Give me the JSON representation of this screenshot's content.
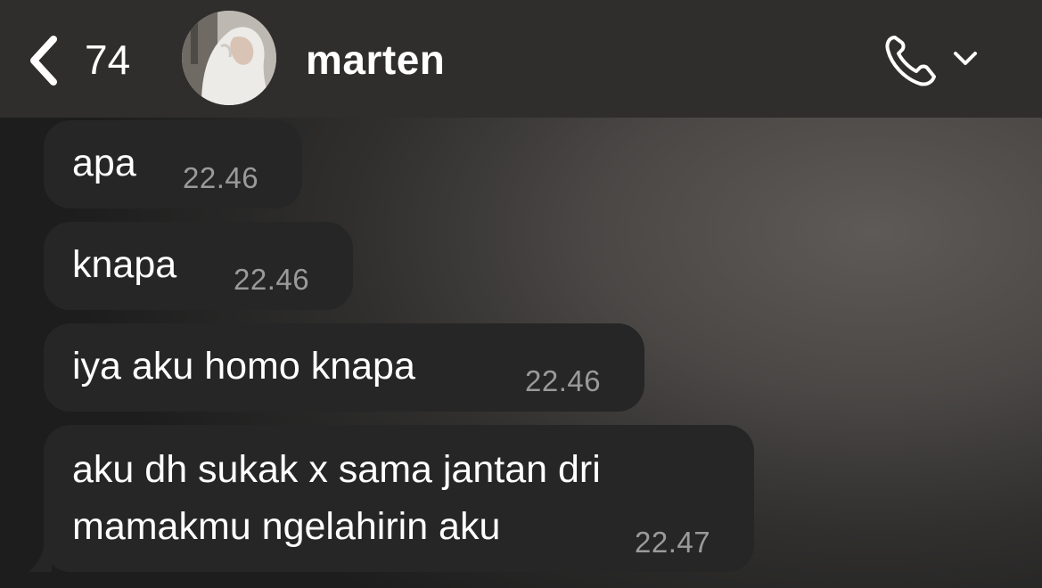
{
  "header": {
    "back_icon": "chevron-left-icon",
    "unread_count": "74",
    "contact_name": "marten",
    "call_icon": "phone-icon",
    "dropdown_icon": "chevron-down-icon"
  },
  "colors": {
    "header_bg": "#2f2e2c",
    "bubble_bg": "#262626",
    "text": "#ffffff",
    "timestamp": "#9a9a9a"
  },
  "messages": [
    {
      "text": "apa",
      "time": "22.46"
    },
    {
      "text": "knapa",
      "time": "22.46"
    },
    {
      "text": "iya aku homo knapa",
      "time": "22.46"
    },
    {
      "lines": [
        "aku dh sukak x sama jantan dri",
        "mamakmu ngelahirin aku"
      ],
      "time": "22.47"
    }
  ]
}
